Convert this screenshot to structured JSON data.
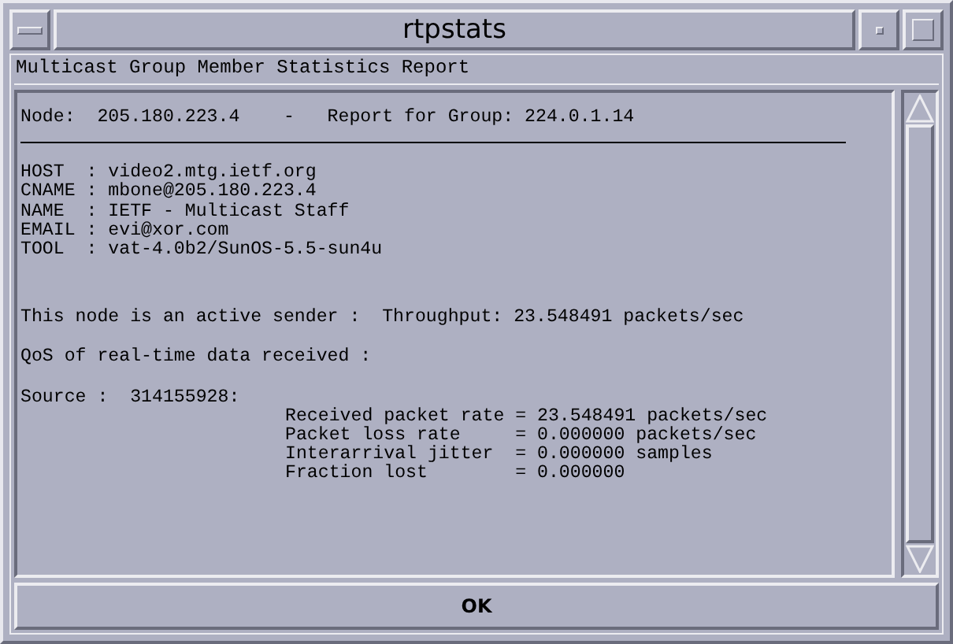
{
  "window": {
    "title": "rtpstats"
  },
  "header": "Multicast Group Member Statistics Report",
  "report": {
    "node_line": "Node:  205.180.223.4    -   Report for Group: 224.0.1.14",
    "fields": [
      "HOST  : video2.mtg.ietf.org",
      "CNAME : mbone@205.180.223.4",
      "NAME  : IETF - Multicast Staff",
      "EMAIL : evi@xor.com",
      "TOOL  : vat-4.0b2/SunOS-5.5-sun4u"
    ],
    "sender_line": "This node is an active sender :  Throughput: 23.548491 packets/sec",
    "qos_line": "QoS of real-time data received :",
    "source_line": "Source :  314155928:",
    "stats": [
      "Received packet rate = 23.548491 packets/sec",
      "Packet loss rate     = 0.000000 packets/sec",
      "Interarrival jitter  = 0.000000 samples",
      "Fraction lost        = 0.000000"
    ]
  },
  "buttons": [
    "OK"
  ]
}
